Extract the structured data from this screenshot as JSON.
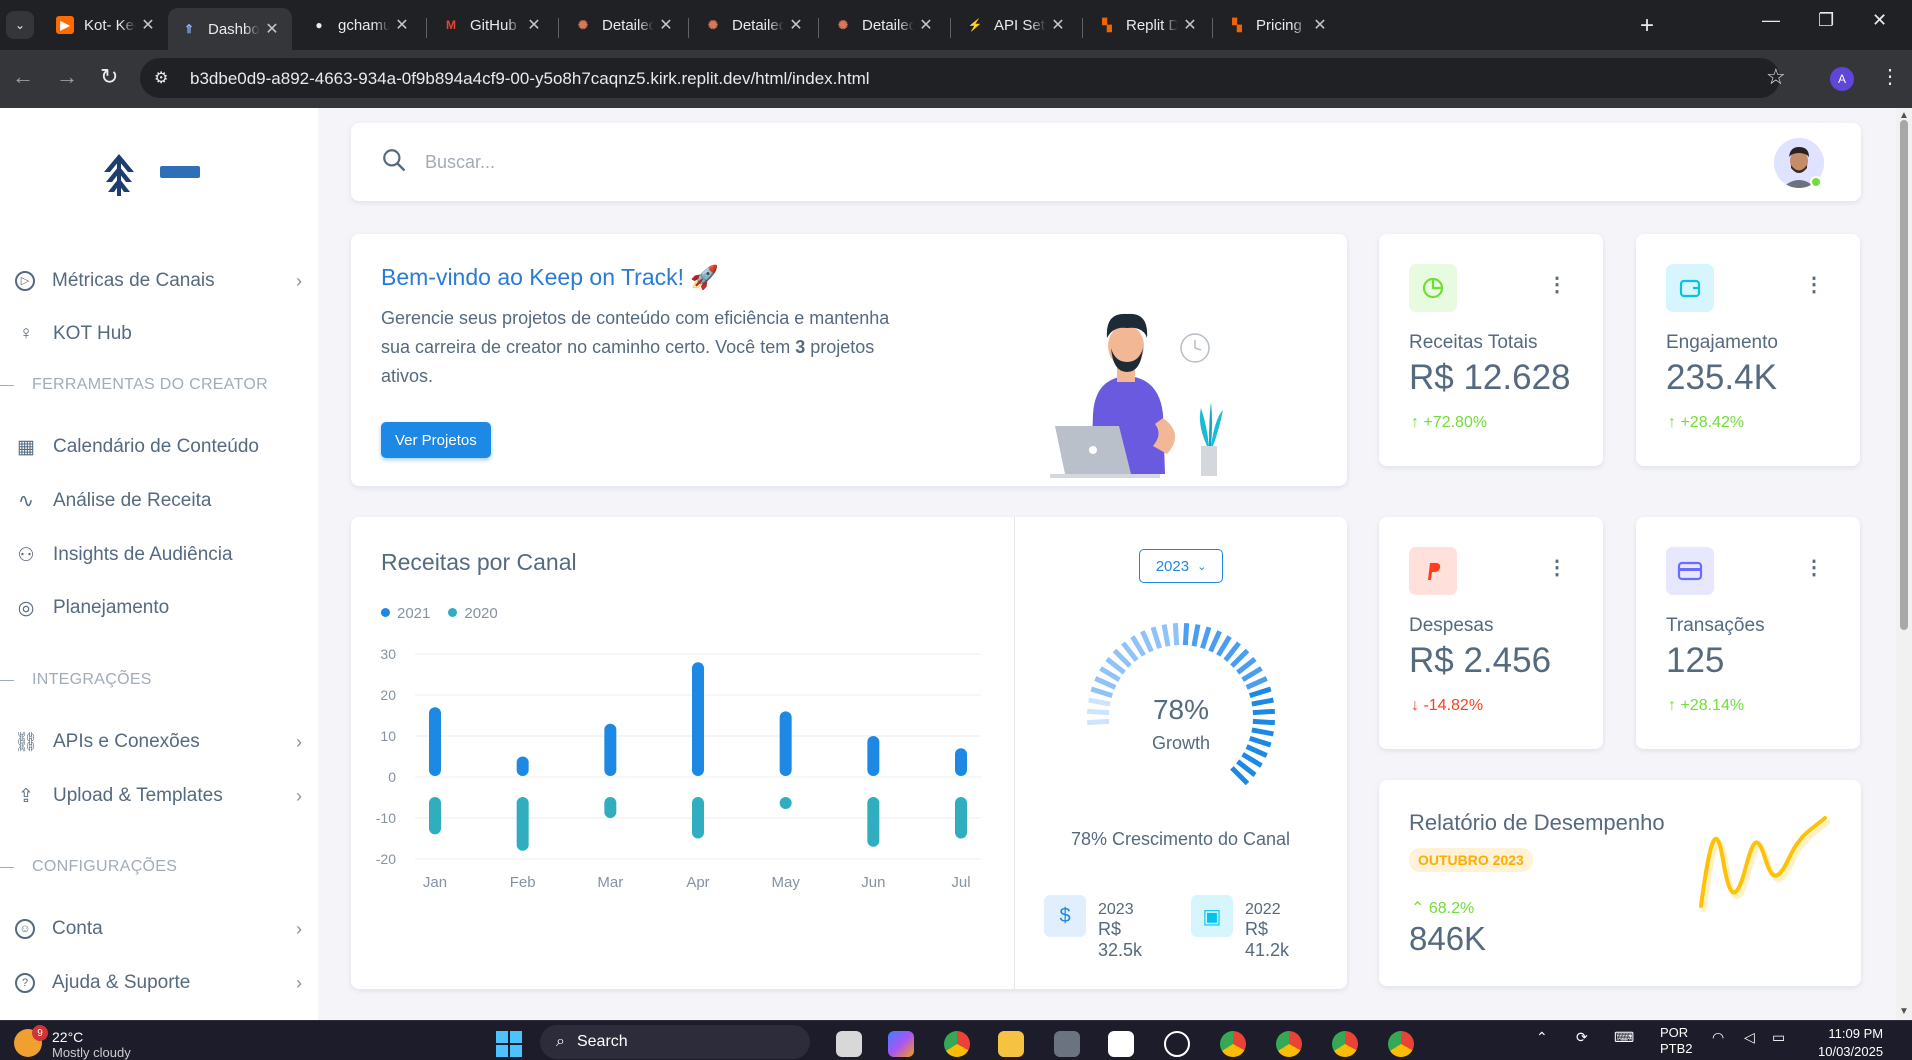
{
  "browser": {
    "tabs": [
      {
        "title": "Kot- Keep",
        "active": false
      },
      {
        "title": "Dashboard",
        "active": true
      },
      {
        "title": "gchamusca",
        "active": false
      },
      {
        "title": "GitHub Co",
        "active": false
      },
      {
        "title": "Detailed Fi",
        "active": false
      },
      {
        "title": "Detailed Pi",
        "active": false
      },
      {
        "title": "Detailed Pr",
        "active": false
      },
      {
        "title": "API Setting",
        "active": false
      },
      {
        "title": "Replit Doc",
        "active": false
      },
      {
        "title": "Pricing - R",
        "active": false
      }
    ],
    "url": "b3dbe0d9-a892-4663-934a-0f9b894a4cf9-00-y5o8h7caqnz5.kirk.replit.dev/html/index.html",
    "profile_initial": "A"
  },
  "sidebar": {
    "items_top": [
      {
        "label": "Métricas de Canais",
        "icon": "play-circle-icon",
        "chevron": true
      },
      {
        "label": "KOT Hub",
        "icon": "bulb-icon",
        "chevron": false
      }
    ],
    "section_creator": "FERRAMENTAS DO CREATOR",
    "items_creator": [
      {
        "label": "Calendário de Conteúdo",
        "icon": "calendar-icon"
      },
      {
        "label": "Análise de Receita",
        "icon": "line-chart-icon"
      },
      {
        "label": "Insights de Audiência",
        "icon": "users-icon"
      },
      {
        "label": "Planejamento",
        "icon": "target-icon"
      }
    ],
    "section_integrations": "INTEGRAÇÕES",
    "items_integrations": [
      {
        "label": "APIs e Conexões",
        "icon": "link-icon"
      },
      {
        "label": "Upload & Templates",
        "icon": "upload-icon"
      }
    ],
    "section_config": "CONFIGURAÇÕES",
    "items_config": [
      {
        "label": "Conta",
        "icon": "user-circle-icon"
      },
      {
        "label": "Ajuda & Suporte",
        "icon": "help-icon"
      }
    ]
  },
  "search": {
    "placeholder": "Buscar..."
  },
  "welcome": {
    "title": "Bem-vindo ao Keep on Track! 🚀",
    "text_before": "Gerencie seus projetos de conteúdo com eficiência e mantenha sua carreira de creator no caminho certo. Você tem ",
    "projects_count": "3",
    "text_after": " projetos ativos.",
    "button": "Ver Projetos"
  },
  "stats": [
    {
      "label": "Receitas Totais",
      "value": "R$ 12.628",
      "trend": "+72.80%",
      "direction": "up",
      "icon": "pie-chart-icon",
      "color": "#71dd37",
      "bg": "#e8fadf"
    },
    {
      "label": "Engajamento",
      "value": "235.4K",
      "trend": "+28.42%",
      "direction": "up",
      "icon": "wallet-icon",
      "color": "#03c3ec",
      "bg": "#d7f5fc"
    },
    {
      "label": "Despesas",
      "value": "R$ 2.456",
      "trend": "-14.82%",
      "direction": "down",
      "icon": "paypal-icon",
      "color": "#ff3e1d",
      "bg": "#ffe0db"
    },
    {
      "label": "Transações",
      "value": "125",
      "trend": "+28.14%",
      "direction": "up",
      "icon": "credit-card-icon",
      "color": "#696cff",
      "bg": "#e7e7ff"
    }
  ],
  "revenue": {
    "title": "Receitas por Canal",
    "year_select": "2023",
    "growth_percent": "78%",
    "growth_label": "Growth",
    "growth_value": 78,
    "growth_caption": "78% Crescimento do Canal",
    "mini": [
      {
        "year": "2023",
        "value": "R$ 32.5k",
        "icon": "dollar-icon",
        "color": "#1e88e5",
        "bg": "#e1effc"
      },
      {
        "year": "2022",
        "value": "R$ 41.2k",
        "icon": "wallet-icon",
        "color": "#03c3ec",
        "bg": "#d7f5fc"
      }
    ]
  },
  "chart_data": {
    "type": "bar",
    "categories": [
      "Jan",
      "Feb",
      "Mar",
      "Apr",
      "May",
      "Jun",
      "Jul"
    ],
    "series": [
      {
        "name": "2021",
        "values": [
          17,
          5,
          13,
          28,
          16,
          10,
          7
        ],
        "color": "#1e88e5"
      },
      {
        "name": "2020",
        "values": [
          -14,
          -18,
          -10,
          -15,
          -5,
          -17,
          -15
        ],
        "color": "#30aec0"
      }
    ],
    "yticks": [
      30,
      20,
      10,
      0,
      -10,
      -20
    ],
    "ylim": [
      -20,
      30
    ],
    "grid": true,
    "legend": "top-left",
    "xlabel": "",
    "ylabel": ""
  },
  "performance": {
    "title": "Relatório de Desempenho",
    "badge": "OUTUBRO 2023",
    "trend": "68.2%",
    "value": "846K",
    "accent": "#ffab00"
  },
  "taskbar": {
    "weather_temp": "22°C",
    "weather_desc": "Mostly cloudy",
    "weather_badge": "9",
    "search": "Search",
    "lang": "POR",
    "lang2": "PTB2",
    "time": "11:09 PM",
    "date": "10/03/2025"
  }
}
